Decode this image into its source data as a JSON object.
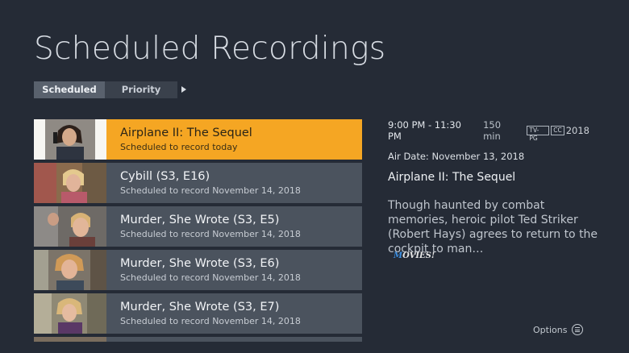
{
  "page": {
    "title": "Scheduled Recordings"
  },
  "tabs": [
    {
      "label": "Scheduled",
      "active": true
    },
    {
      "label": "Priority",
      "active": false
    }
  ],
  "recordings": [
    {
      "title": "Airplane II: The Sequel",
      "status": "Scheduled to record today",
      "selected": true
    },
    {
      "title": "Cybill (S3, E16)",
      "status": "Scheduled to record November 14, 2018",
      "selected": false
    },
    {
      "title": "Murder, She Wrote (S3, E5)",
      "status": "Scheduled to record November 14, 2018",
      "selected": false
    },
    {
      "title": "Murder, She Wrote (S3, E6)",
      "status": "Scheduled to record November 14, 2018",
      "selected": false
    },
    {
      "title": "Murder, She Wrote (S3, E7)",
      "status": "Scheduled to record November 14, 2018",
      "selected": false
    }
  ],
  "details": {
    "time": "9:00 PM - 11:30 PM",
    "duration": "150 min",
    "rating": "TV-PG",
    "cc": "CC",
    "year": "2018",
    "air_date": "Air Date: November 13, 2018",
    "title": "Airplane II: The Sequel",
    "description": "Though haunted by combat memories, heroic pilot Ted Striker (Robert Hays) agrees to return to the cockpit to man…",
    "network_logo": "MOVIES!"
  },
  "footer": {
    "options_label": "Options",
    "options_icon": "menu-circle-icon"
  },
  "colors": {
    "accent": "#f5a623",
    "background": "#252b36",
    "row": "#4b535e"
  }
}
